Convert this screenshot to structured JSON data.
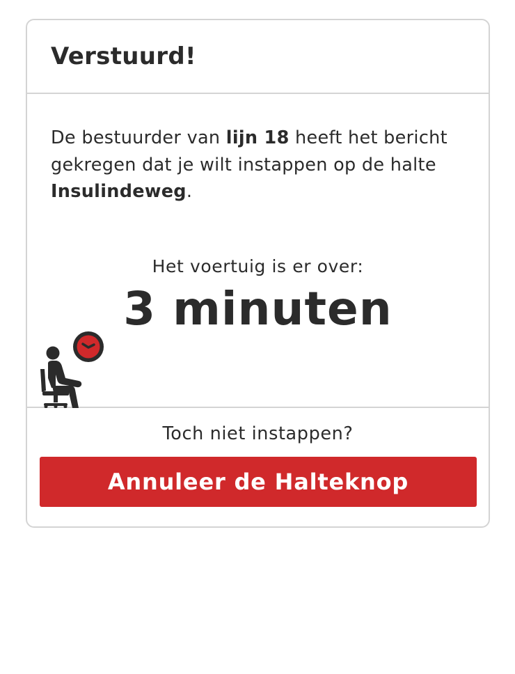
{
  "header": {
    "title": "Verstuurd!"
  },
  "message": {
    "part1": "De bestuurder van ",
    "line": "lijn 18",
    "part2": " heeft het bericht gekregen dat je wilt instappen op de halte ",
    "stop": "Insulindeweg",
    "part3": "."
  },
  "eta": {
    "label": "Het voertuig is er over:",
    "value": "3 minuten"
  },
  "footer": {
    "question": "Toch niet instappen?",
    "cancel_label": "Annuleer de Halteknop"
  },
  "colors": {
    "accent": "#d0292b",
    "text": "#2b2b2b",
    "border": "#d4d4d4"
  },
  "icons": {
    "illustration": "waiting-person-with-clock-icon"
  }
}
